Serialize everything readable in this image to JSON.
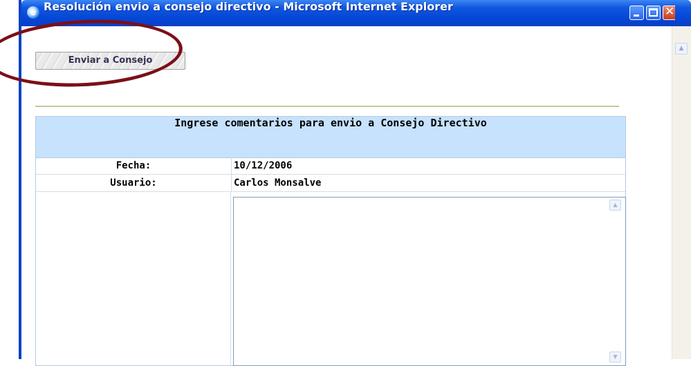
{
  "window": {
    "title": "Resolución envio a consejo directivo - Microsoft Internet Explorer"
  },
  "toolbar": {
    "send_label": "Enviar a Consejo"
  },
  "form": {
    "header": "Ingrese comentarios para envio a Consejo Directivo",
    "fecha_label": "Fecha:",
    "fecha_value": "10/12/2006",
    "usuario_label": "Usuario:",
    "usuario_value": "Carlos Monsalve",
    "comment_value": ""
  },
  "colors": {
    "titlebar": "#0546d6",
    "form_header": "#c6e2fd",
    "annotation": "#7a1018"
  }
}
